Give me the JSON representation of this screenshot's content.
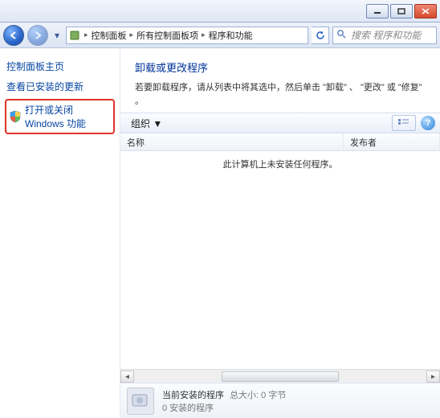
{
  "titlebar": {},
  "nav": {
    "breadcrumb": [
      "控制面板",
      "所有控制面板项",
      "程序和功能"
    ],
    "search_placeholder": "搜索 程序和功能"
  },
  "sidebar": {
    "links": [
      {
        "label": "控制面板主页"
      },
      {
        "label": "查看已安装的更新"
      }
    ],
    "highlighted": {
      "label": "打开或关闭 Windows 功能"
    }
  },
  "main": {
    "heading": "卸载或更改程序",
    "description": "若要卸载程序，请从列表中将其选中，然后单击 \"卸载\" 、 \"更改\" 或 \"修复\" 。",
    "toolbar": {
      "organize": "组织 ▼"
    },
    "columns": {
      "name": "名称",
      "publisher": "发布者"
    },
    "empty": "此计算机上未安装任何程序。"
  },
  "footer": {
    "title": "当前安装的程序",
    "size_label": "总大小: 0 字节",
    "count": "0 安装的程序"
  }
}
